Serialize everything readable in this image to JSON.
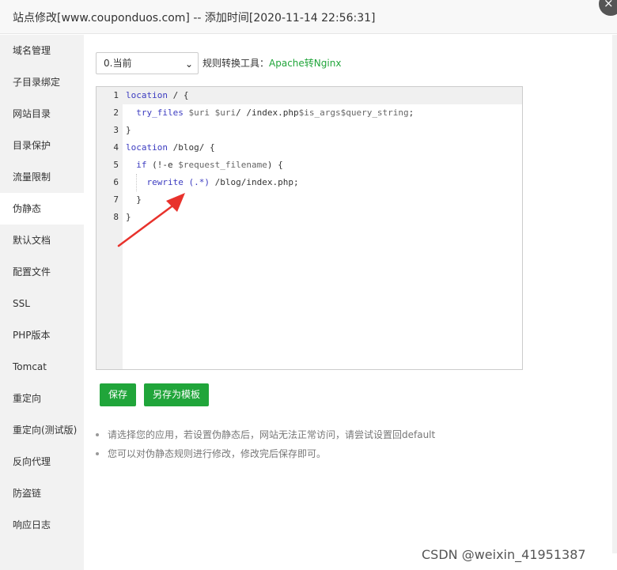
{
  "window": {
    "title": "站点修改[www.couponduos.com] -- 添加时间[2020-11-14 22:56:31]",
    "close_symbol": "×"
  },
  "sidebar": {
    "items": [
      {
        "label": "域名管理",
        "active": false
      },
      {
        "label": "子目录绑定",
        "active": false
      },
      {
        "label": "网站目录",
        "active": false
      },
      {
        "label": "目录保护",
        "active": false
      },
      {
        "label": "流量限制",
        "active": false
      },
      {
        "label": "伪静态",
        "active": true
      },
      {
        "label": "默认文档",
        "active": false
      },
      {
        "label": "配置文件",
        "active": false
      },
      {
        "label": "SSL",
        "active": false
      },
      {
        "label": "PHP版本",
        "active": false
      },
      {
        "label": "Tomcat",
        "active": false
      },
      {
        "label": "重定向",
        "active": false
      },
      {
        "label": "重定向(测试版)",
        "active": false
      },
      {
        "label": "反向代理",
        "active": false
      },
      {
        "label": "防盗链",
        "active": false
      },
      {
        "label": "响应日志",
        "active": false
      }
    ]
  },
  "rewrite": {
    "version_select": {
      "selected": "0.当前",
      "icon": "chevron-down-icon"
    },
    "tool_label": "规则转换工具：",
    "tool_link": "Apache转Nginx",
    "editor": {
      "line_numbers": [
        "1",
        "2",
        "3",
        "4",
        "5",
        "6",
        "7",
        "8"
      ],
      "lines": [
        "location / {",
        "  try_files $uri $uri/ /index.php$is_args$query_string;",
        "}",
        "location /blog/ {",
        "  if (!-e $request_filename) {",
        "    rewrite (.*) /blog/index.php;",
        "  }",
        "}"
      ]
    },
    "save_button": "保存",
    "save_template_button": "另存为模板",
    "tips": [
      "请选择您的应用，若设置伪静态后，网站无法正常访问，请尝试设置回default",
      "您可以对伪静态规则进行修改，修改完后保存即可。"
    ]
  },
  "annotation": {
    "arrow_color": "#e8322c"
  },
  "watermark": "CSDN @weixin_41951387",
  "colors": {
    "accent": "#20a53a",
    "sidebar_bg": "#f2f2f2",
    "keyword": "#3c3cc0"
  }
}
